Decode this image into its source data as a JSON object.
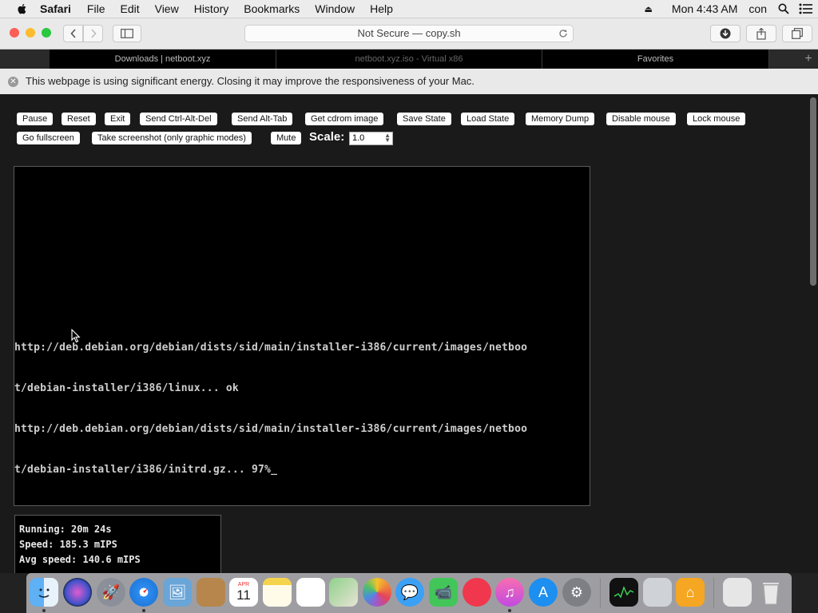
{
  "menubar": {
    "app": "Safari",
    "items": [
      "File",
      "Edit",
      "View",
      "History",
      "Bookmarks",
      "Window",
      "Help"
    ],
    "clock": "Mon 4:43 AM",
    "user": "con"
  },
  "toolbar": {
    "address": "Not Secure — copy.sh"
  },
  "tabs": [
    {
      "label": "Downloads | netboot.xyz"
    },
    {
      "label": "netboot.xyz.iso - Virtual x86"
    },
    {
      "label": "Favorites"
    }
  ],
  "banner": {
    "message": "This webpage is using significant energy. Closing it may improve the responsiveness of your Mac."
  },
  "controls": {
    "pause": "Pause",
    "reset": "Reset",
    "exit": "Exit",
    "ctrl_alt_del": "Send Ctrl-Alt-Del",
    "alt_tab": "Send Alt-Tab",
    "cdrom": "Get cdrom image",
    "save_state": "Save State",
    "load_state": "Load State",
    "memory_dump": "Memory Dump",
    "disable_mouse": "Disable mouse",
    "lock_mouse": "Lock mouse",
    "fullscreen": "Go fullscreen",
    "screenshot": "Take screenshot (only graphic modes)",
    "mute": "Mute",
    "scale_label": "Scale:",
    "scale_value": "1.0"
  },
  "console": {
    "lines": [
      "http://deb.debian.org/debian/dists/sid/main/installer-i386/current/images/netboo",
      "t/debian-installer/i386/linux... ok",
      "http://deb.debian.org/debian/dists/sid/main/installer-i386/current/images/netboo",
      "t/debian-installer/i386/initrd.gz... 97%_"
    ]
  },
  "stats": {
    "running": "Running: 20m 24s",
    "speed": "Speed: 185.3 mIPS",
    "avg_speed": "Avg speed: 140.6 mIPS"
  },
  "dock": {
    "apps": [
      "finder",
      "siri",
      "launchpad",
      "safari",
      "preview",
      "contacts",
      "calendar",
      "notes",
      "reminders",
      "maps",
      "photos",
      "messages",
      "facetime",
      "news",
      "music",
      "app-store",
      "system-preferences",
      "activity-monitor",
      "terminal",
      "home",
      "downloads",
      "trash"
    ],
    "calendar_month": "APR",
    "calendar_day": "11"
  },
  "colors": {
    "close": "#fc5f57",
    "minimize": "#fdbc2e",
    "zoom": "#2ac840"
  }
}
